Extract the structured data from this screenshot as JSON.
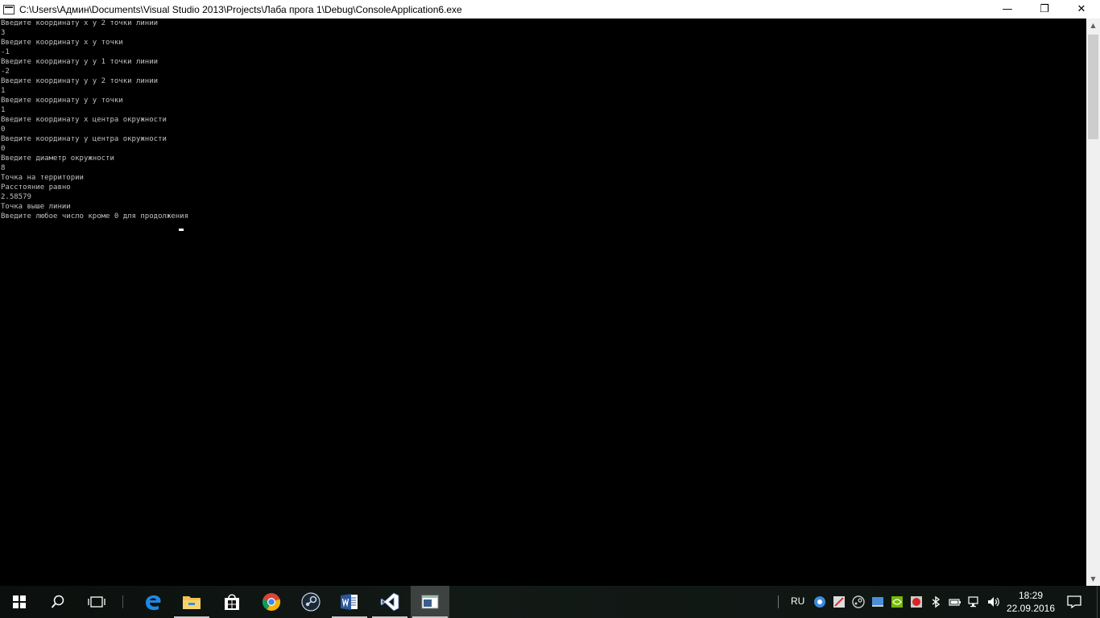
{
  "window": {
    "title": "C:\\Users\\Админ\\Documents\\Visual Studio 2013\\Projects\\Лаба прога 1\\Debug\\ConsoleApplication6.exe",
    "minimize_glyph": "—",
    "maximize_glyph": "❐",
    "close_glyph": "✕"
  },
  "console": {
    "lines": [
      "Введите координату x у 2 точки линии",
      "3",
      "Введите координату x у точки",
      "-1",
      "Введите координату y у 1 точки линии",
      "-2",
      "Введите координату y у 2 точки линии",
      "1",
      "Введите координату y у точки",
      "1",
      "Введите координату x центра окружности",
      "0",
      "Введите координату y центра окружности",
      "0",
      "Введите диаметр окружности",
      "8",
      "Точка на территории",
      "Расстояние равно",
      "2.58579",
      "Точка выше линии",
      "Введите любое число кроме 0 для продолжения"
    ]
  },
  "taskbar": {
    "language": "RU",
    "time": "18:29",
    "date": "22.09.2016",
    "pinned": [
      {
        "name": "edge",
        "icon": "edge-icon"
      },
      {
        "name": "file-explorer",
        "icon": "folder-icon"
      },
      {
        "name": "store",
        "icon": "store-icon"
      },
      {
        "name": "chrome",
        "icon": "chrome-icon"
      },
      {
        "name": "steam",
        "icon": "steam-icon"
      },
      {
        "name": "word",
        "icon": "word-icon"
      },
      {
        "name": "visual-studio",
        "icon": "visual-studio-icon"
      },
      {
        "name": "console",
        "icon": "console-icon"
      }
    ],
    "colors": {
      "edge": "#1e88e5",
      "folder": "#f2c14e",
      "chrome_red": "#db4437",
      "chrome_green": "#0f9d58",
      "chrome_yellow": "#f4b400",
      "chrome_blue": "#4285f4",
      "word": "#2b579a",
      "vs": "#68217a"
    }
  }
}
